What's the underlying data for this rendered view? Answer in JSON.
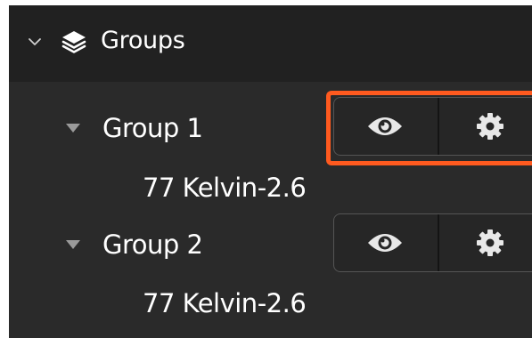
{
  "header": {
    "title": "Groups",
    "chevron_icon": "chevron-down-icon",
    "layers_icon": "layers-icon"
  },
  "groups": [
    {
      "label": "Group 1",
      "items": [
        "77 Kelvin-2.6"
      ],
      "actions": [
        "eye-icon",
        "gear-icon"
      ],
      "highlighted": true
    },
    {
      "label": "Group 2",
      "items": [
        "77 Kelvin-2.6"
      ],
      "actions": [
        "eye-icon",
        "gear-icon"
      ],
      "highlighted": false
    }
  ],
  "colors": {
    "panel_bg": "#2a2a2a",
    "header_bg": "#212121",
    "highlight": "#ff5a1f",
    "icon": "#e8e8e8",
    "caret": "#9a9a9a"
  }
}
